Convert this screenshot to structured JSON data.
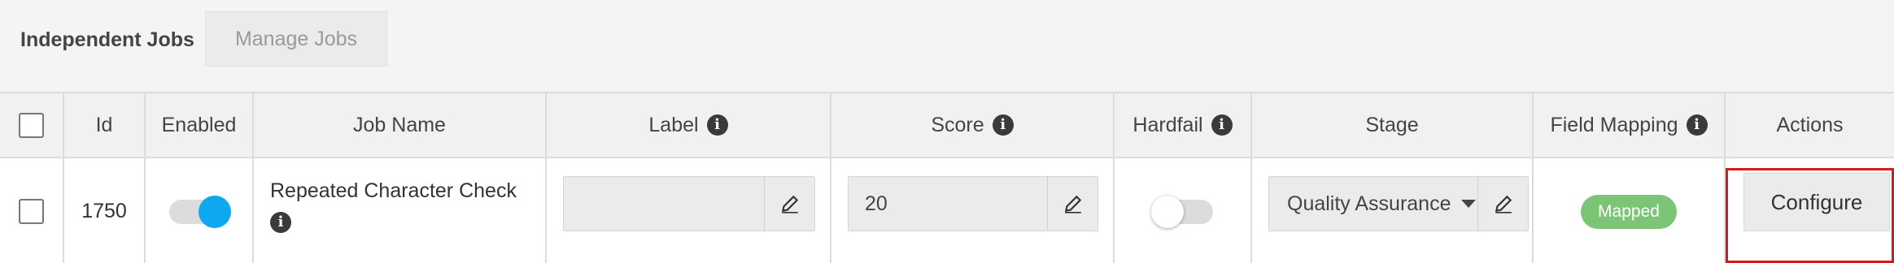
{
  "header": {
    "title": "Independent Jobs",
    "manage_button": "Manage Jobs"
  },
  "table": {
    "columns": {
      "id": "Id",
      "enabled": "Enabled",
      "job_name": "Job Name",
      "label": "Label",
      "score": "Score",
      "hardfail": "Hardfail",
      "stage": "Stage",
      "field_mapping": "Field Mapping",
      "actions": "Actions"
    },
    "rows": [
      {
        "checked": false,
        "id": "1750",
        "enabled": true,
        "job_name": "Repeated Character Check",
        "label_value": "",
        "score_value": "20",
        "hardfail": false,
        "stage": "Quality Assurance",
        "field_mapping": "Mapped",
        "action": "Configure"
      }
    ]
  },
  "colors": {
    "toggle_on": "#0da8f0",
    "badge_mapped": "#7cc576",
    "highlight": "#d7191c"
  },
  "icons": [
    "info-icon",
    "pencil-icon",
    "caret-down-icon"
  ]
}
